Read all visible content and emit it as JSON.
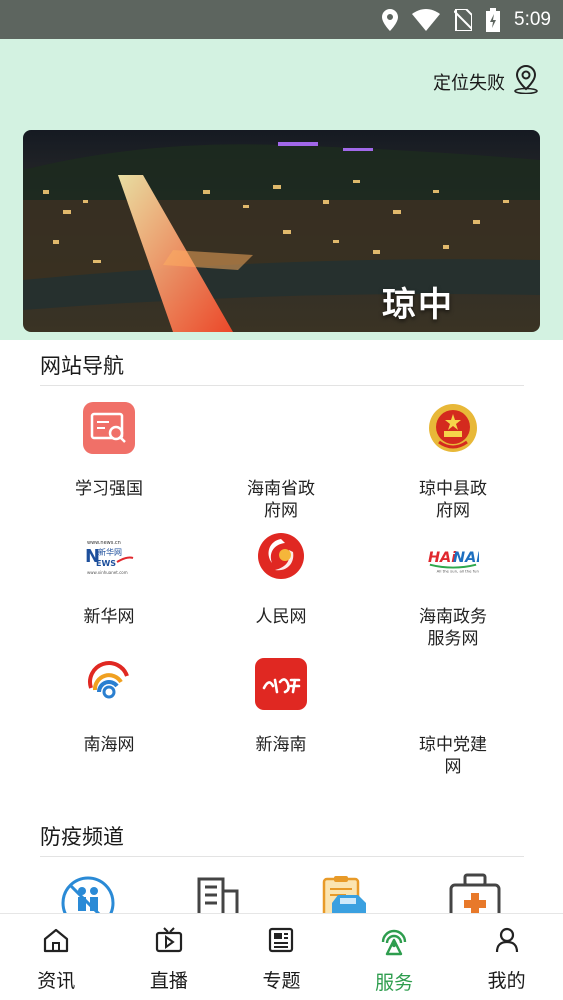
{
  "status_bar": {
    "time": "5:09"
  },
  "header": {
    "location_text": "定位失败"
  },
  "banner": {
    "title": "琼中"
  },
  "site_nav": {
    "title": "网站导航",
    "items": [
      {
        "label": "学习强国",
        "icon": "xuexi-qiangguo-icon"
      },
      {
        "label": "海南省政府网",
        "icon": "blank-icon"
      },
      {
        "label": "琼中县政府网",
        "icon": "national-emblem-icon"
      },
      {
        "label": "新华网",
        "icon": "xinhua-logo-icon"
      },
      {
        "label": "人民网",
        "icon": "people-logo-icon"
      },
      {
        "label": "海南政务服务网",
        "icon": "hainan-logo-icon"
      },
      {
        "label": "南海网",
        "icon": "nanhai-logo-icon"
      },
      {
        "label": "新海南",
        "icon": "xinhainan-logo-icon"
      },
      {
        "label": "琼中党建网",
        "icon": "blank-icon"
      }
    ]
  },
  "epidemic": {
    "title": "防疫频道",
    "icons": [
      "no-gathering-icon",
      "building-icon",
      "vehicle-checklist-icon",
      "medical-kit-icon"
    ]
  },
  "bottom_nav": {
    "tabs": [
      {
        "label": "资讯",
        "icon": "home-icon"
      },
      {
        "label": "直播",
        "icon": "tv-live-icon"
      },
      {
        "label": "专题",
        "icon": "newspaper-icon"
      },
      {
        "label": "服务",
        "icon": "service-signal-icon",
        "active": true
      },
      {
        "label": "我的",
        "icon": "user-icon"
      }
    ]
  },
  "colors": {
    "accent": "#2e9d4e",
    "header_bg": "#d3f2e1",
    "status_bar_bg": "#5d655f"
  }
}
